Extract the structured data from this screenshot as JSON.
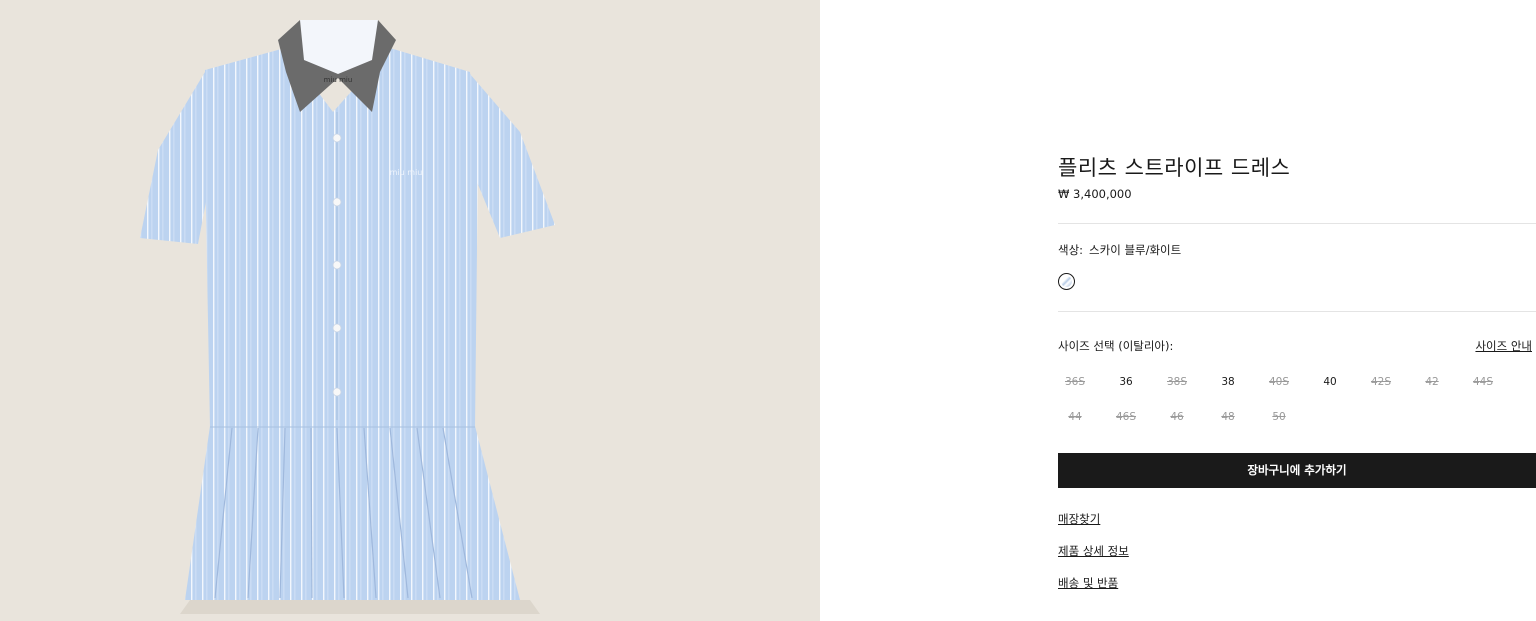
{
  "product": {
    "title": "플리츠 스트라이프 드레스",
    "price": "₩ 3,400,000",
    "image_label": "miu miu"
  },
  "color": {
    "label": "색상:",
    "value": "스카이 블루/화이트"
  },
  "size": {
    "label": "사이즈 선택 (이탈리아):",
    "guide_label": "사이즈 안내",
    "options": [
      {
        "label": "36S",
        "available": false
      },
      {
        "label": "36",
        "available": true
      },
      {
        "label": "38S",
        "available": false
      },
      {
        "label": "38",
        "available": true
      },
      {
        "label": "40S",
        "available": false
      },
      {
        "label": "40",
        "available": true
      },
      {
        "label": "42S",
        "available": false
      },
      {
        "label": "42",
        "available": false
      },
      {
        "label": "44S",
        "available": false
      },
      {
        "label": "44",
        "available": false
      },
      {
        "label": "46S",
        "available": false
      },
      {
        "label": "46",
        "available": false
      },
      {
        "label": "48",
        "available": false
      },
      {
        "label": "50",
        "available": false
      }
    ]
  },
  "cart": {
    "label": "장바구니에 추가하기"
  },
  "links": {
    "store": "매장찾기",
    "details": "제품 상세 정보",
    "shipping": "배송 및 반품"
  },
  "colors": {
    "panel_bg": "#e9e4dc",
    "shirt_blue": "#bcd3f0",
    "collar_grey": "#6b6b6b",
    "button_bg": "#1a1a1a",
    "unavailable_text": "#9a9a9a"
  }
}
